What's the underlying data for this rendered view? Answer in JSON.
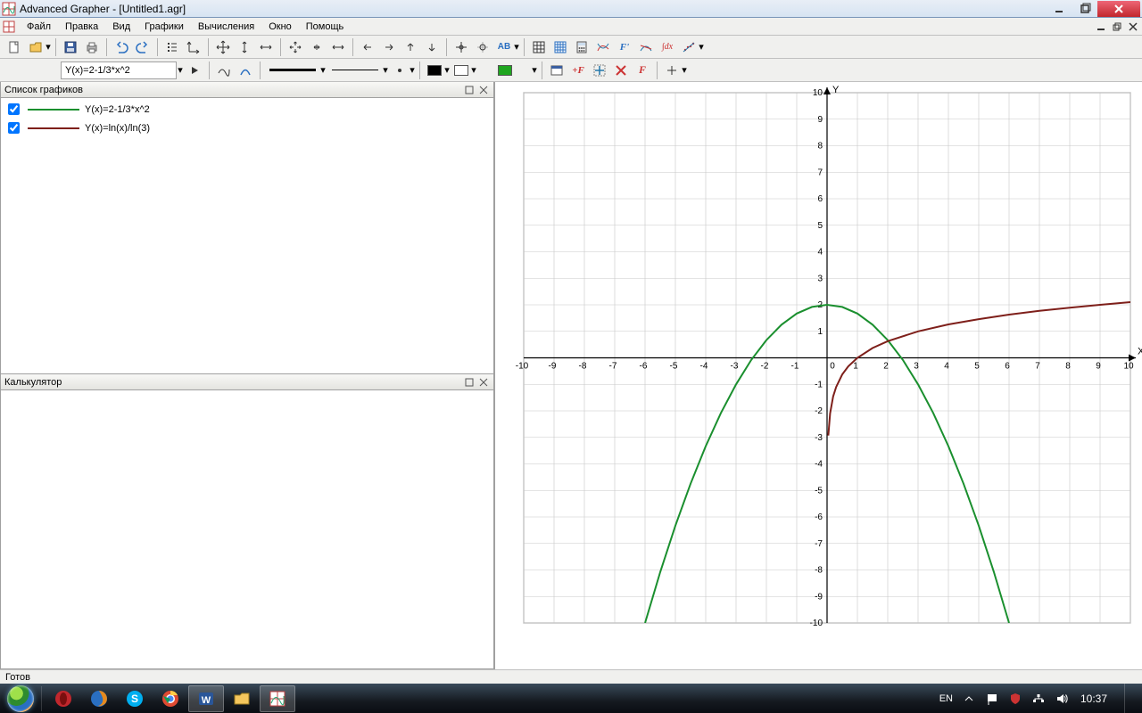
{
  "window": {
    "title": "Advanced Grapher - [Untitled1.agr]"
  },
  "menu": {
    "file": "Файл",
    "edit": "Правка",
    "view": "Вид",
    "graphs": "Графики",
    "calc": "Вычисления",
    "window": "Окно",
    "help": "Помощь"
  },
  "formula_bar": {
    "current": "Y(x)=2-1/3*x^2"
  },
  "colors": {
    "series1": "#1a8f2e",
    "series2": "#7e1f1a",
    "selector_main": "#1fa51f",
    "swatch_black": "#000000",
    "swatch_white": "#ffffff"
  },
  "panels": {
    "graphlist_title": "Список графиков",
    "calc_title": "Калькулятор",
    "items": [
      {
        "checked": true,
        "color": "#1a8f2e",
        "label": "Y(x)=2-1/3*x^2"
      },
      {
        "checked": true,
        "color": "#7e1f1a",
        "label": "Y(x)=ln(x)/ln(3)"
      }
    ]
  },
  "axes": {
    "xlabel": "X",
    "ylabel": "Y",
    "x_ticks": [
      "-10",
      "-9",
      "-8",
      "-7",
      "-6",
      "-5",
      "-4",
      "-3",
      "-2",
      "-1",
      "0",
      "1",
      "2",
      "3",
      "4",
      "5",
      "6",
      "7",
      "8",
      "9",
      "10"
    ],
    "y_ticks": [
      "10",
      "9",
      "8",
      "7",
      "6",
      "5",
      "4",
      "3",
      "2",
      "1",
      "-1",
      "-2",
      "-3",
      "-4",
      "-5",
      "-6",
      "-7",
      "-8",
      "-9",
      "-10"
    ]
  },
  "status": {
    "ready": "Готов"
  },
  "taskbar": {
    "lang": "EN",
    "clock": "10:37"
  },
  "chart_data": {
    "type": "line",
    "title": "",
    "xlabel": "X",
    "ylabel": "Y",
    "xlim": [
      -10,
      10
    ],
    "ylim": [
      -10,
      10
    ],
    "series": [
      {
        "name": "Y(x)=2-1/3*x^2",
        "color": "#1a8f2e",
        "x": [
          -6,
          -5.5,
          -5,
          -4.5,
          -4,
          -3.5,
          -3,
          -2.5,
          -2,
          -1.5,
          -1,
          -0.5,
          0,
          0.5,
          1,
          1.5,
          2,
          2.5,
          3,
          3.5,
          4,
          4.5,
          5,
          5.5,
          6
        ],
        "values": [
          -10,
          -8.08,
          -6.33,
          -4.75,
          -3.33,
          -2.08,
          -1,
          -0.08,
          0.67,
          1.25,
          1.67,
          1.92,
          2,
          1.92,
          1.67,
          1.25,
          0.67,
          -0.08,
          -1,
          -2.08,
          -3.33,
          -4.75,
          -6.33,
          -8.08,
          -10
        ]
      },
      {
        "name": "Y(x)=ln(x)/ln(3)",
        "color": "#7e1f1a",
        "x": [
          0.04,
          0.1,
          0.2,
          0.3,
          0.5,
          0.7,
          1,
          1.5,
          2,
          3,
          4,
          5,
          6,
          7,
          8,
          9,
          10
        ],
        "values": [
          -2.93,
          -2.1,
          -1.46,
          -1.1,
          -0.63,
          -0.32,
          0,
          0.37,
          0.63,
          1.0,
          1.26,
          1.46,
          1.63,
          1.77,
          1.89,
          2.0,
          2.1
        ]
      }
    ]
  }
}
